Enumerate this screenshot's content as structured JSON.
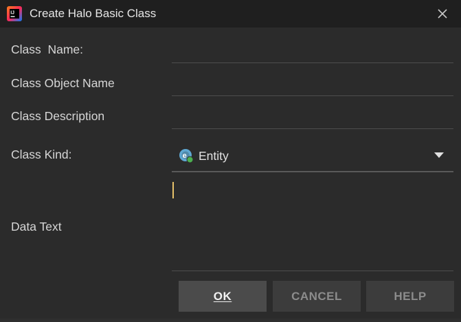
{
  "window": {
    "title": "Create Halo Basic Class",
    "app_icon": "intellij-idea-icon",
    "close_icon": "close-icon"
  },
  "form": {
    "class_name": {
      "label": "Class  Name:",
      "value": ""
    },
    "class_object_name": {
      "label": "Class Object Name",
      "value": ""
    },
    "class_description": {
      "label": "Class Description",
      "value": ""
    },
    "class_kind": {
      "label": "Class Kind:",
      "selected": "Entity",
      "icon": "entity-class-icon"
    },
    "data_text": {
      "label": "Data Text",
      "value": ""
    }
  },
  "buttons": {
    "ok": "OK",
    "cancel": "CANCEL",
    "help": "HELP"
  },
  "colors": {
    "accent_caret": "#e8c36a",
    "titlebar_bg": "#1f1f1f",
    "dialog_bg": "#2b2b2b"
  }
}
